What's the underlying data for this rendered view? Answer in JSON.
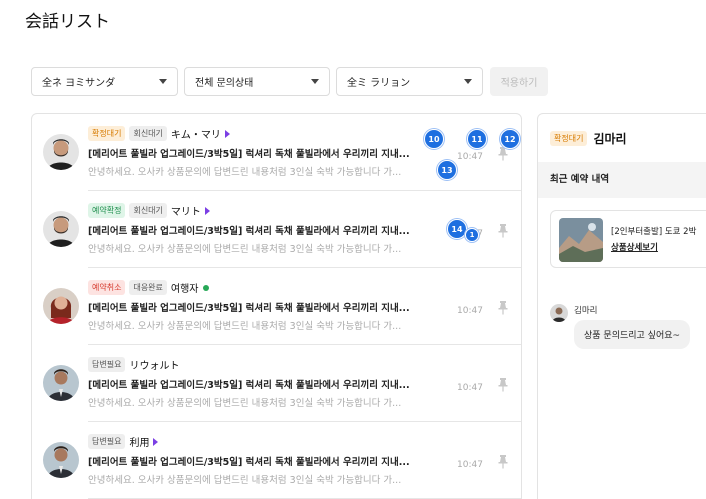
{
  "page": {
    "title": "会話リスト"
  },
  "filters": {
    "agent": "全ネ ヨミサンダ",
    "status": "전체 문의상태",
    "region": "全ミ ラリョン",
    "apply_label": "적용하기"
  },
  "conversations": [
    {
      "badges": [
        {
          "text": "확정대기",
          "color": "orange"
        },
        {
          "text": "회신대기",
          "color": "gray"
        }
      ],
      "name": "キム・マリ",
      "status_dot": "purple-arrow",
      "subject": "[메리어트 풀빌라 업그레이드/3박5일] 럭셔리 독채 풀빌라에서 우리끼리 지내...",
      "preview": "안녕하세요. 오사카 상품문의에 답변드린 내용처럼 3인실 숙박 가능합니다 가...",
      "time": "10:47",
      "avatar": "man-beard"
    },
    {
      "badges": [
        {
          "text": "예약확정",
          "color": "green"
        },
        {
          "text": "회신대기",
          "color": "gray"
        }
      ],
      "name": "マリト",
      "status_dot": "purple-arrow",
      "subject": "[메리어트 풀빌라 업그레이드/3박5일] 럭셔리 독채 풀빌라에서 우리끼리 지내...",
      "preview": "안녕하세요. 오사카 상품문의에 답변드린 내용처럼 3인실 숙박 가능합니다 가...",
      "time": "10:47",
      "avatar": "man-beard"
    },
    {
      "badges": [
        {
          "text": "예약취소",
          "color": "red"
        },
        {
          "text": "대응완료",
          "color": "gray"
        }
      ],
      "name": "여행자",
      "status_dot": "green",
      "subject": "[메리어트 풀빌라 업그레이드/3박5일] 럭셔리 독채 풀빌라에서 우리끼리 지내...",
      "preview": "안녕하세요. 오사카 상품문의에 답변드린 내용처럼 3인실 숙박 가능합니다 가...",
      "time": "10:47",
      "avatar": "woman-red"
    },
    {
      "badges": [
        {
          "text": "답변필요",
          "color": "gray"
        }
      ],
      "name": "リウォルト",
      "status_dot": "",
      "subject": "[메리어트 풀빌라 업그레이드/3박5일] 럭셔리 독채 풀빌라에서 우리끼리 지내...",
      "preview": "안녕하세요. 오사카 상품문의에 답변드린 내용처럼 3인실 숙박 가능합니다 가...",
      "time": "10:47",
      "avatar": "man-suit"
    },
    {
      "badges": [
        {
          "text": "답변필요",
          "color": "gray"
        }
      ],
      "name": "利用",
      "status_dot": "purple-arrow",
      "subject": "[메리어트 풀빌라 업그레이드/3박5일] 럭셔리 독채 풀빌라에서 우리끼리 지내...",
      "preview": "안녕하세요. 오사카 상품문의에 답변드린 내용처럼 3인실 숙박 가능합니다 가...",
      "time": "10:47",
      "avatar": "man-suit"
    }
  ],
  "markers": [
    "10",
    "11",
    "12",
    "13",
    "14",
    "1"
  ],
  "detail": {
    "badge": "확정대기",
    "name": "김마리",
    "section_title": "최근 예약 내역",
    "booking_title": "[2인부터출발] 도쿄 2박",
    "booking_link": "상품상세보기",
    "chat_name": "김마리",
    "chat_message": "상품 문의드리고 싶어요~"
  },
  "colors": {
    "accent_blue": "#1e6fe0",
    "badge_orange": "#d77b00",
    "badge_green": "#1f8f4e",
    "badge_red": "#d63b2f",
    "status_purple": "#7b3fe4"
  }
}
